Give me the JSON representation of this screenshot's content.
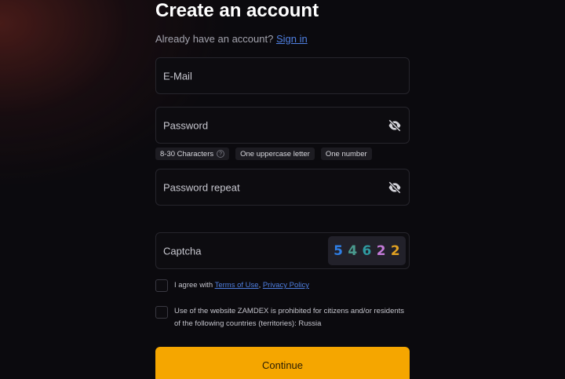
{
  "header": {
    "title": "Create an account",
    "signin_prompt": "Already have an account?",
    "signin_link": "Sign in"
  },
  "form": {
    "email_label": "E-Mail",
    "password_label": "Password",
    "password_repeat_label": "Password repeat",
    "captcha_label": "Captcha",
    "password_rules": [
      "8-30 Characters",
      "One uppercase letter",
      "One number"
    ],
    "help_icon": "?",
    "captcha_digits": [
      {
        "digit": "5",
        "color": "#2f7fe6"
      },
      {
        "digit": "4",
        "color": "#4a9a8e"
      },
      {
        "digit": "6",
        "color": "#2f9aa0"
      },
      {
        "digit": "2",
        "color": "#c37ad8"
      },
      {
        "digit": "2",
        "color": "#e0a021"
      }
    ]
  },
  "agreements": {
    "terms_prefix": "I agree with",
    "terms_link": "Terms of Use",
    "separator": ",",
    "privacy_link": "Privacy Policy",
    "restriction_text": "Use of the website ZAMDEX is prohibited for citizens and/or residents of the following countries (territories): Russia"
  },
  "actions": {
    "continue_label": "Continue"
  },
  "colors": {
    "accent": "#f5a600",
    "link": "#4f7fe0",
    "background": "#0b0a0e"
  },
  "icons": {
    "password_toggle": "eye-off-icon",
    "password_repeat_toggle": "eye-off-icon"
  }
}
